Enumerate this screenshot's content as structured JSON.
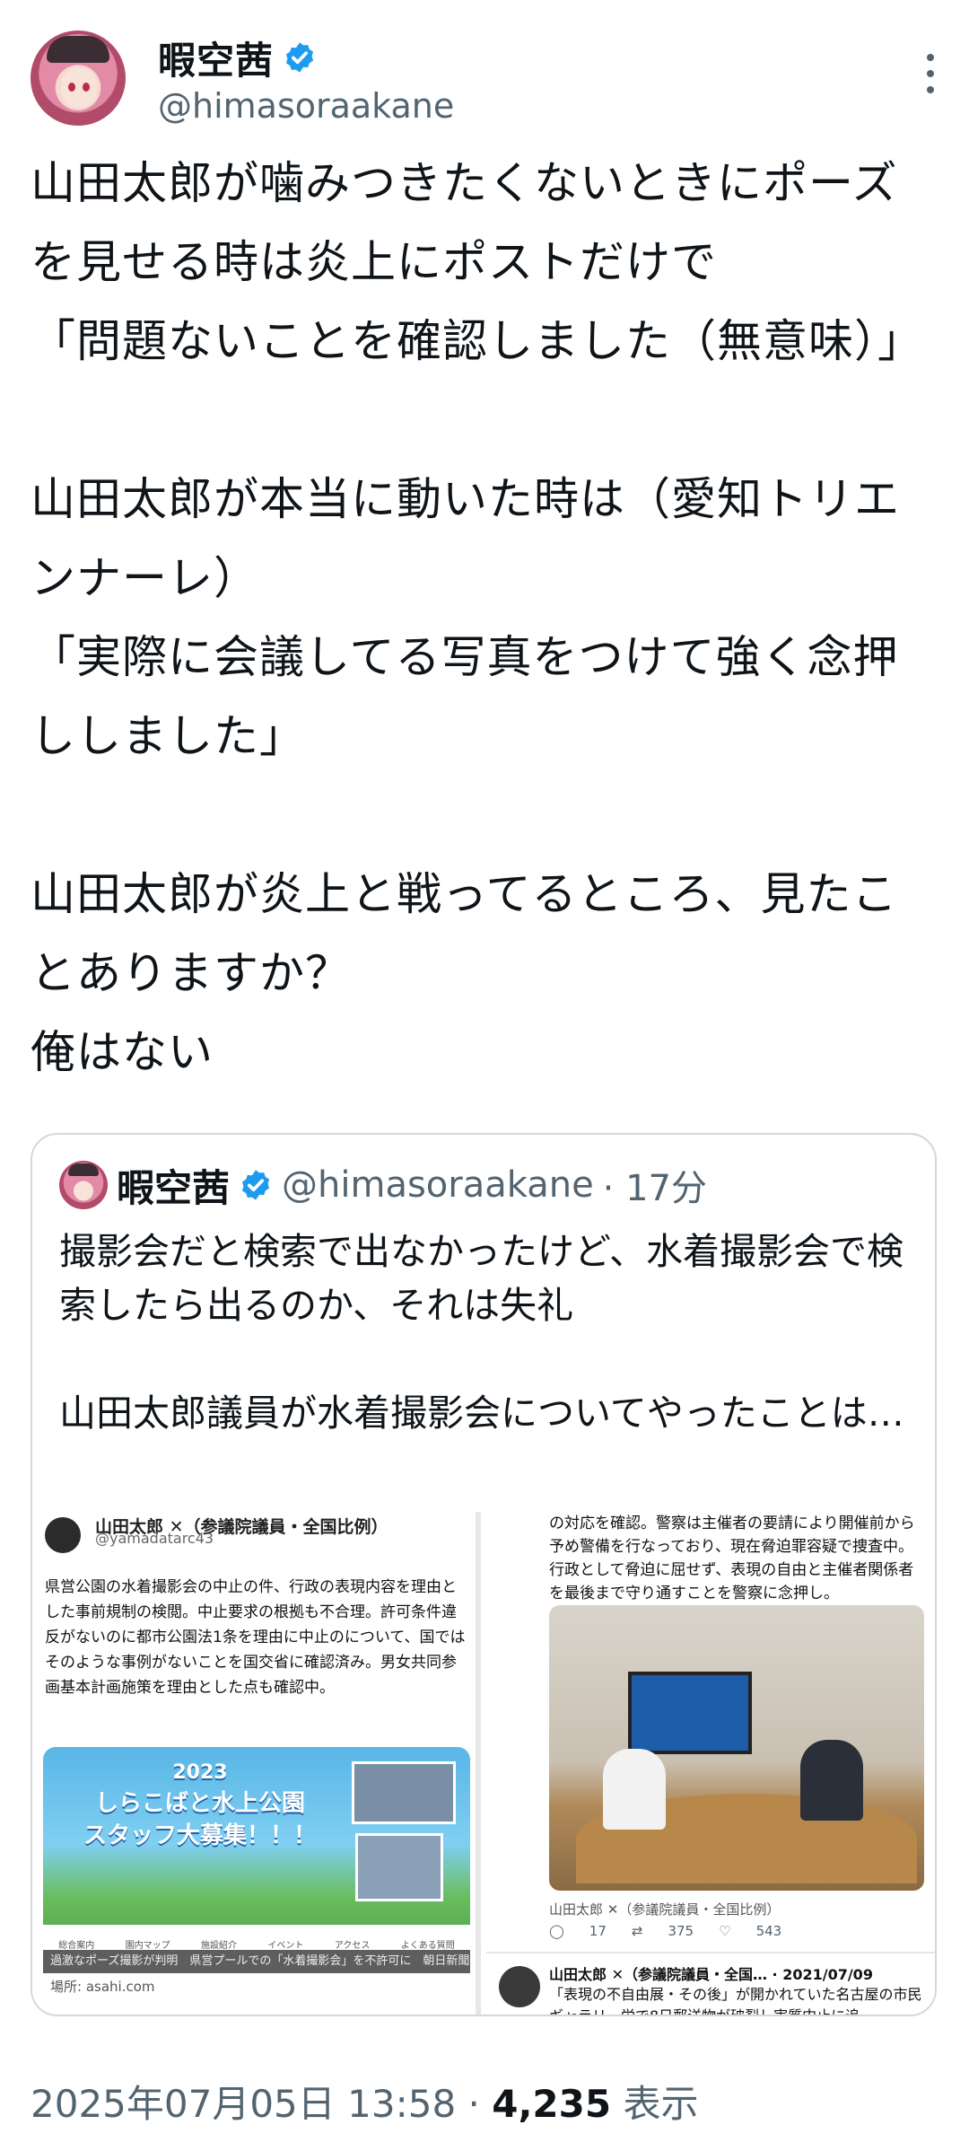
{
  "post": {
    "author_name": "暇空茜",
    "author_handle": "@himasoraakane",
    "body": "山田太郎が噛みつきたくないときにポーズを見せる時は炎上にポストだけで\n「問題ないことを確認しました（無意味）」\n\n山田太郎が本当に動いた時は（愛知トリエンナーレ）\n「実際に会議してる写真をつけて強く念押ししました」\n\n山田太郎が炎上と戦ってるところ、見たことありますか？\n俺はない",
    "timestamp": "2025年07月05日 13:58",
    "separator": "·",
    "views_count": "4,235",
    "views_label": "表示"
  },
  "quote": {
    "author_name": "暇空茜",
    "author_handle": "@himasoraakane",
    "time": "· 17分",
    "text": "撮影会だと検索で出なかったけど、水着撮影会で検索したら出るのか、それは失礼\n\n山田太郎議員が水着撮影会についてやったことは…",
    "media_left": {
      "author": "山田太郎 ✕（参議院議員・全国比例）",
      "handle": "@yamadatarc43",
      "post": "県営公園の水着撮影会の中止の件、行政の表現内容を理由とした事前規制の検閲。中止要求の根拠も不合理。許可条件違反がないのに都市公園法1条を理由に中止のについて、国ではそのような事例がないことを国交省に確認済み。男女共同参画基本計画施策を理由とした点も確認中。",
      "banner_year": "2023",
      "banner_title": "しらこばと水上公園",
      "banner_sub": "スタッフ大募集！！！",
      "banner_nav": [
        "総合案内",
        "園内マップ",
        "施設紹介",
        "イベント",
        "アクセス",
        "よくある質問"
      ],
      "caption": "過激なポーズ撮影が判明　県営プールでの「水着撮影会」を不許可に　朝日新聞",
      "source": "場所: asahi.com"
    },
    "media_right": {
      "text": "の対応を確認。警察は主催者の要請により開催前から予め警備を行なっており、現在脅迫罪容疑で捜査中。行政として脅迫に屈せず、表現の自由と主催者関係者を最後まで守り通すことを警察に念押し。",
      "meta": "山田太郎 ✕（参議院議員・全国比例）",
      "replies": "17",
      "reposts": "375",
      "likes": "543",
      "foot_author": "山田太郎 ✕（参議院議員・全国… · 2021/07/09",
      "foot_text": "「表現の不自由展・その後」が開かれていた名古屋の市民ギャラリー栄で8日郵送物が破裂し実質中止に追"
    }
  },
  "icons": {
    "verified": "verified-badge-icon",
    "more": "more-vertical-icon"
  },
  "colors": {
    "verified_blue": "#1d9bf0",
    "secondary_text": "#536471",
    "border": "#cfd9de"
  }
}
